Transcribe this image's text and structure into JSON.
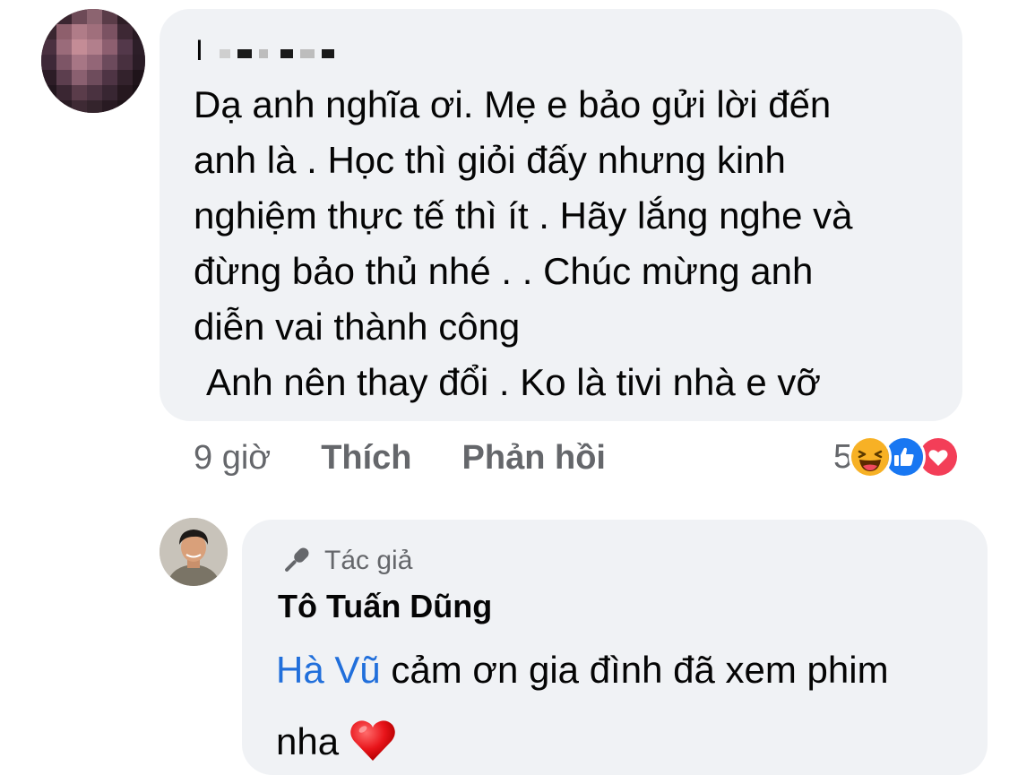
{
  "comment": {
    "author_initial": "I",
    "author_name_redacted": true,
    "text_lines": [
      "Dạ anh nghĩa ơi. Mẹ e bảo gửi lời đến",
      "anh là . Học thì giỏi đấy nhưng kinh",
      "nghiệm thực tế thì ít . Hãy lắng nghe và",
      "đừng bảo thủ nhé . . Chúc mừng anh",
      "diễn vai thành công",
      "Anh nên thay đổi . Ko là tivi nhà e vỡ"
    ],
    "time": "9 giờ",
    "like_label": "Thích",
    "reply_label": "Phản hồi",
    "reaction_count": "5",
    "reactions": [
      "haha-icon",
      "like-icon",
      "love-icon"
    ]
  },
  "reply": {
    "badge_icon": "microphone-icon",
    "badge_label": "Tác giả",
    "author": "Tô Tuấn Dũng",
    "mention": "Hà Vũ",
    "text_line1": " cảm ơn gia đình đã xem phim",
    "text_line2": "nha",
    "emoji": "red-heart-emoji"
  },
  "colors": {
    "bubble": "#f0f2f5",
    "secondary_text": "#65676b",
    "mention": "#216fdb",
    "like_blue": "#1877f2",
    "love_red": "#f33e58",
    "haha_yellow": "#f7b125"
  }
}
